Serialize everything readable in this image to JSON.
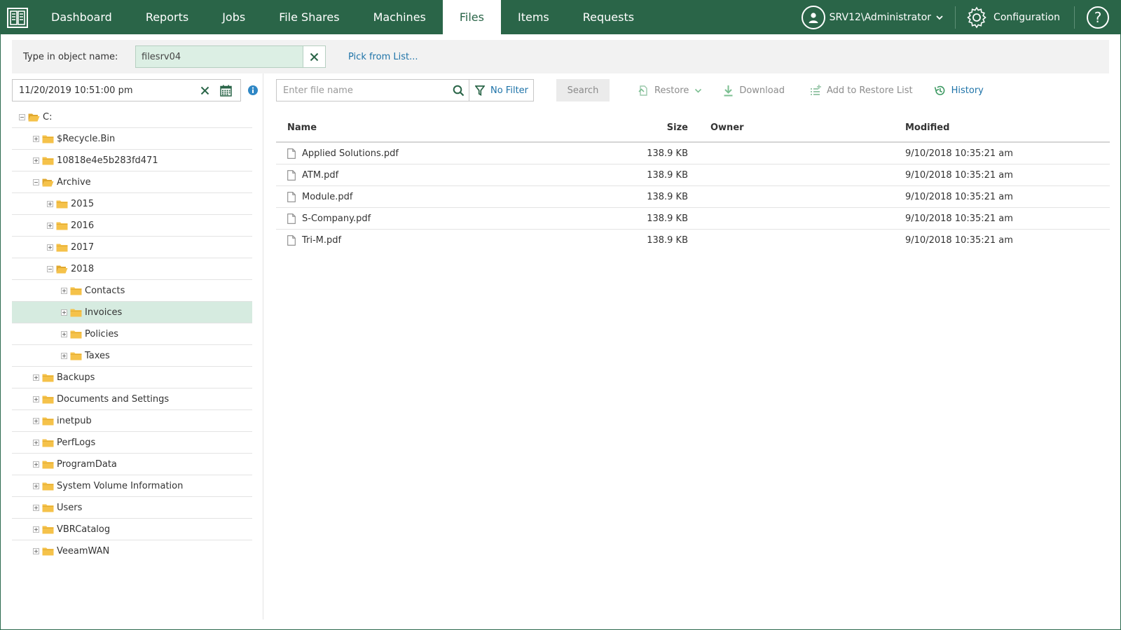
{
  "nav": {
    "tabs": [
      {
        "label": "Dashboard"
      },
      {
        "label": "Reports"
      },
      {
        "label": "Jobs"
      },
      {
        "label": "File Shares"
      },
      {
        "label": "Machines"
      },
      {
        "label": "Files"
      },
      {
        "label": "Items"
      },
      {
        "label": "Requests"
      }
    ],
    "active_tab": "Files",
    "user": "SRV12\\Administrator",
    "configuration": "Configuration",
    "help": "?"
  },
  "object_bar": {
    "label": "Type in object name:",
    "value": "filesrv04",
    "pick_link": "Pick from List..."
  },
  "left": {
    "date_value": "11/20/2019 10:51:00 pm",
    "tree": [
      {
        "label": "C:",
        "expanded": true
      },
      {
        "label": "$Recycle.Bin"
      },
      {
        "label": "10818e4e5b283fd471"
      },
      {
        "label": "Archive",
        "expanded": true
      },
      {
        "label": "2015"
      },
      {
        "label": "2016"
      },
      {
        "label": "2017"
      },
      {
        "label": "2018",
        "expanded": true
      },
      {
        "label": "Contacts"
      },
      {
        "label": "Invoices",
        "selected": true
      },
      {
        "label": "Policies"
      },
      {
        "label": "Taxes"
      },
      {
        "label": "Backups"
      },
      {
        "label": "Documents and Settings"
      },
      {
        "label": "inetpub"
      },
      {
        "label": "PerfLogs"
      },
      {
        "label": "ProgramData"
      },
      {
        "label": "System Volume Information"
      },
      {
        "label": "Users"
      },
      {
        "label": "VBRCatalog"
      },
      {
        "label": "VeeamWAN"
      }
    ]
  },
  "toolbar": {
    "search_placeholder": "Enter file name",
    "filter_label": "No Filter",
    "search_button": "Search",
    "restore": "Restore",
    "download": "Download",
    "add_to_restore_list": "Add to Restore List",
    "history": "History"
  },
  "table": {
    "columns": {
      "name": "Name",
      "size": "Size",
      "owner": "Owner",
      "modified": "Modified"
    },
    "rows": [
      {
        "name": "Applied Solutions.pdf",
        "size": "138.9 KB",
        "owner": "",
        "modified": "9/10/2018 10:35:21 am"
      },
      {
        "name": "ATM.pdf",
        "size": "138.9 KB",
        "owner": "",
        "modified": "9/10/2018 10:35:21 am"
      },
      {
        "name": "Module.pdf",
        "size": "138.9 KB",
        "owner": "",
        "modified": "9/10/2018 10:35:21 am"
      },
      {
        "name": "S-Company.pdf",
        "size": "138.9 KB",
        "owner": "",
        "modified": "9/10/2018 10:35:21 am"
      },
      {
        "name": "Tri-M.pdf",
        "size": "138.9 KB",
        "owner": "",
        "modified": "9/10/2018 10:35:21 am"
      }
    ]
  },
  "colors": {
    "brand_green": "#2a6548",
    "link_blue": "#1e73a8",
    "selected_row": "#d6ebe0",
    "folder_yellow": "#f5c24a"
  }
}
